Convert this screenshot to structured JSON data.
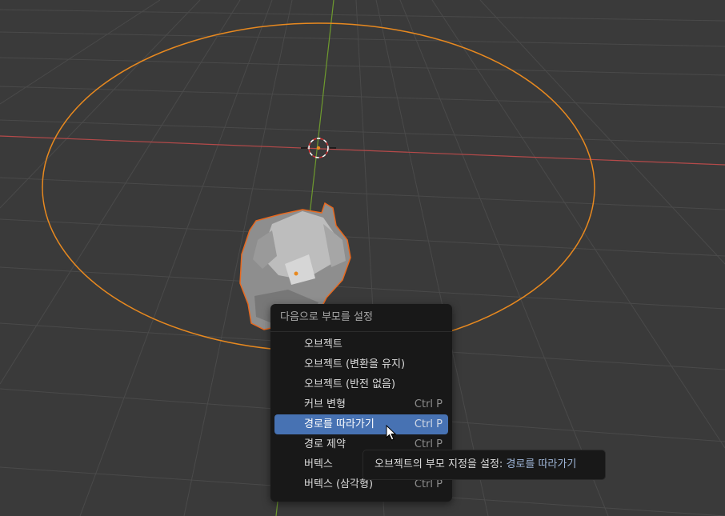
{
  "menu": {
    "title": "다음으로 부모를 설정",
    "items": [
      {
        "label": "오브젝트",
        "shortcut": ""
      },
      {
        "label": "오브젝트 (변환을 유지)",
        "shortcut": ""
      },
      {
        "label": "오브젝트 (반전 없음)",
        "shortcut": ""
      },
      {
        "label": "커브 변형",
        "shortcut": "Ctrl P"
      },
      {
        "label": "경로를 따라가기",
        "shortcut": "Ctrl P"
      },
      {
        "label": "경로 제약",
        "shortcut": "Ctrl P"
      },
      {
        "label": "버텍스",
        "shortcut": ""
      },
      {
        "label": "버텍스 (삼각형)",
        "shortcut": "Ctrl P"
      }
    ]
  },
  "tooltip": {
    "text": "오브젝트의 부모 지정을 설정:",
    "value": "경로를 따라가기"
  },
  "colors": {
    "background": "#3a3a3a",
    "grid": "#4a4a4a",
    "x_axis": "#b54a4a",
    "y_axis": "#6e9a2e",
    "selection_outline": "#e8891f",
    "menu_highlight": "#4772b3"
  }
}
